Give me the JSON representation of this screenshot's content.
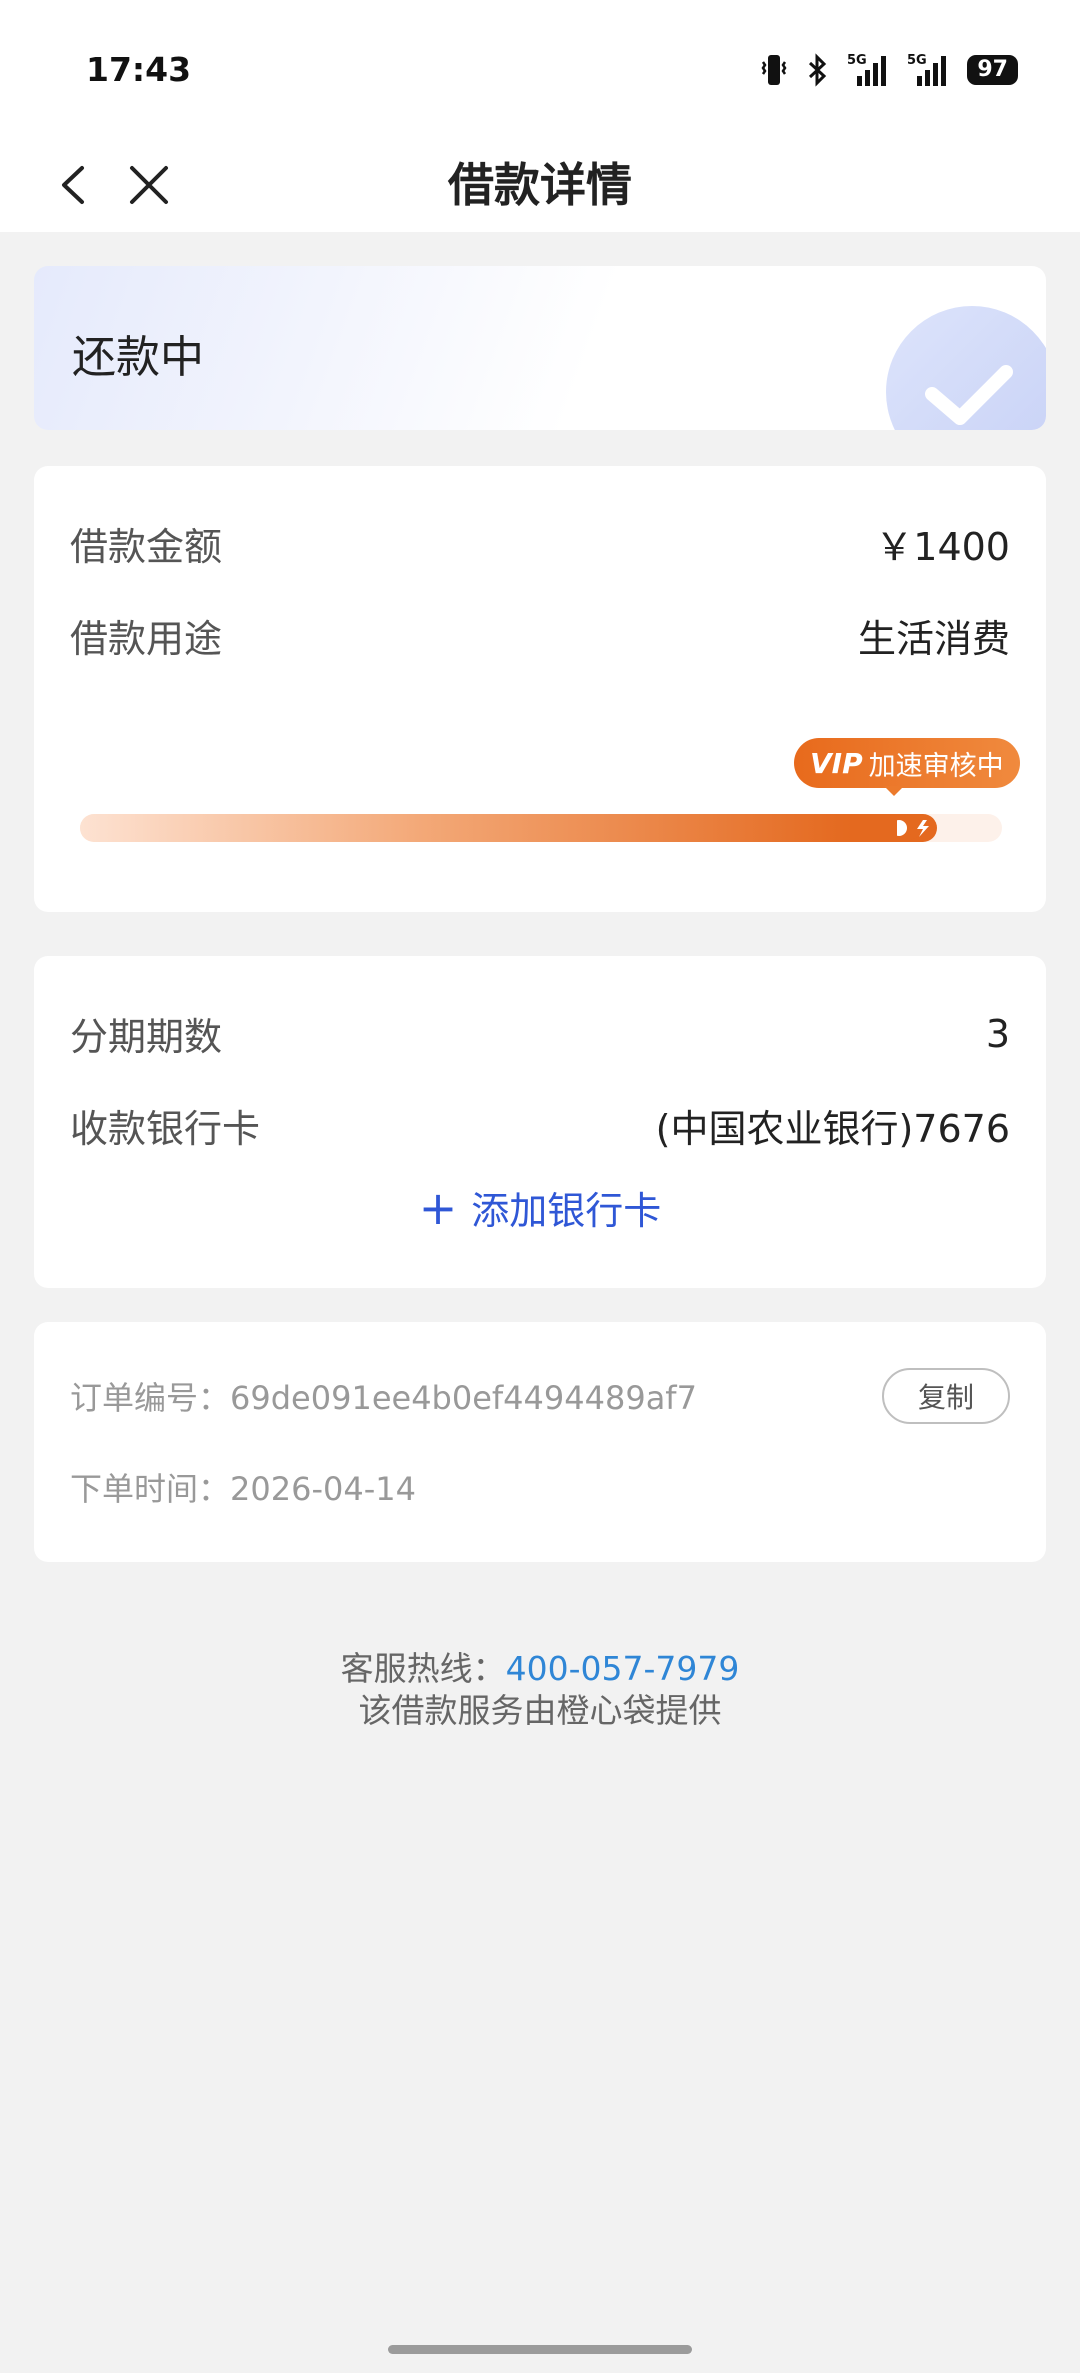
{
  "status_bar": {
    "time": "17:43",
    "battery": "97",
    "icons": [
      "vibrate-icon",
      "bluetooth-icon",
      "signal-5g-icon",
      "signal-5g-icon"
    ]
  },
  "nav": {
    "title": "借款详情",
    "back_icon": "chevron-left-icon",
    "close_icon": "close-icon"
  },
  "loan_status": {
    "label": "还款中",
    "icon": "checkmark-icon"
  },
  "loan_info": {
    "amount_label": "借款金额",
    "amount_value": "￥1400",
    "purpose_label": "借款用途",
    "purpose_value": "生活消费",
    "vip_mark": "VIP",
    "vip_badge_text": "加速审核中",
    "progress_fraction": 0.93
  },
  "installment": {
    "periods_label": "分期期数",
    "periods_value": "3",
    "bank_label": "收款银行卡",
    "bank_value": "(中国农业银行)7676",
    "add_card_label": "添加银行卡"
  },
  "order": {
    "number_label": "订单编号：",
    "number_value": "69de091ee4b0ef4494489af7",
    "copy_label": "复制",
    "time_label": "下单时间：",
    "time_value": "2026-04-14"
  },
  "footer": {
    "hotline_label": "客服热线：",
    "hotline_number": "400-057-7979",
    "provider_note": "该借款服务由橙心袋提供"
  },
  "colors": {
    "accent_orange": "#e4691f",
    "link_blue": "#2f57d6",
    "hotline_blue": "#2f86d6"
  }
}
